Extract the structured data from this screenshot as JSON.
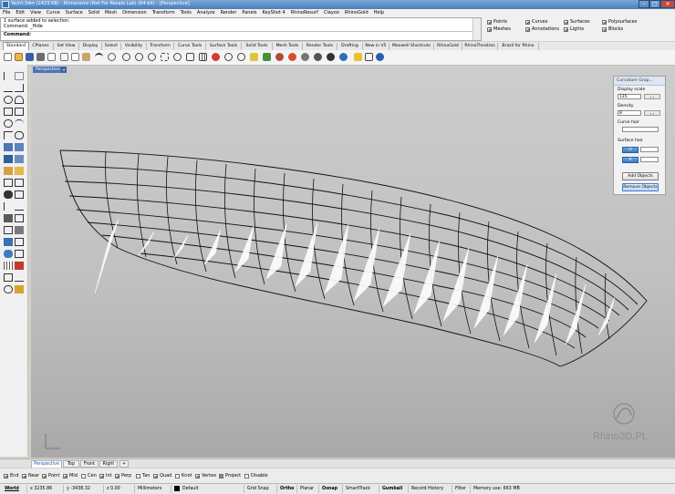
{
  "window": {
    "title": "Yacht.3dm (2423 KB) - Rhinoceros (Not For Resale Lab) (64-bit) - [Perspective]",
    "buttons": [
      "–",
      "□",
      "✕"
    ]
  },
  "menu": [
    "File",
    "Edit",
    "View",
    "Curve",
    "Surface",
    "Solid",
    "Mesh",
    "Dimension",
    "Transform",
    "Tools",
    "Analyze",
    "Render",
    "Panels",
    "KeyShot 4",
    "RhinoResurf",
    "Clayoo",
    "RhinoGold",
    "Help"
  ],
  "command": {
    "history": [
      "1 surface added to selection.",
      "Command: _Hide"
    ],
    "prompt": "Command:"
  },
  "select_filters": [
    "Points",
    "Curves",
    "Surfaces",
    "Polysurfaces",
    "Meshes",
    "Annotations",
    "Lights",
    "Blocks"
  ],
  "toolbar_tabs": [
    "Standard",
    "CPlanes",
    "Set View",
    "Display",
    "Select",
    "Visibility",
    "Transform",
    "Curve Tools",
    "Surface Tools",
    "Solid Tools",
    "Mesh Tools",
    "Render Tools",
    "Drafting",
    "New in V5",
    "Maxwell Shortcuts",
    "RhinoGold",
    "RhinoTheatros",
    "Brazil for Rhino"
  ],
  "viewport": {
    "title": "Perspective",
    "watermark": "RhinoЗD.PL"
  },
  "curvature_panel": {
    "title": "Curvature Grap...",
    "display_scale_label": "Display scale",
    "display_scale_value": "135",
    "density_label": "Density",
    "density_value": "8",
    "curve_hair_label": "Curve hair",
    "surface_hair_label": "Surface hair",
    "u_label": "U",
    "v_label": "V",
    "add_objects": "Add Objects",
    "remove_objects": "Remove Objects"
  },
  "view_tabs": [
    "Perspective",
    "Top",
    "Front",
    "Right"
  ],
  "add_view_icon": "plus-icon",
  "osnaps": [
    {
      "label": "End",
      "checked": true
    },
    {
      "label": "Near",
      "checked": true
    },
    {
      "label": "Point",
      "checked": true
    },
    {
      "label": "Mid",
      "checked": true
    },
    {
      "label": "Cen",
      "checked": false
    },
    {
      "label": "Int",
      "checked": true
    },
    {
      "label": "Perp",
      "checked": true
    },
    {
      "label": "Tan",
      "checked": false
    },
    {
      "label": "Quad",
      "checked": true
    },
    {
      "label": "Knot",
      "checked": false
    },
    {
      "label": "Vertex",
      "checked": true
    },
    {
      "label": "Project",
      "checked": false
    },
    {
      "label": "Disable",
      "checked": false
    }
  ],
  "status": {
    "cplane": "World",
    "x": "x 3235.86",
    "y": "y -3438.32",
    "z": "z 0.00",
    "units": "Millimeters",
    "layer": "Default",
    "grid_snap": "Grid Snap",
    "ortho": "Ortho",
    "planar": "Planar",
    "osnap": "Osnap",
    "smarttrack": "SmartTrack",
    "gumball": "Gumball",
    "record_history": "Record History",
    "filter": "Filter",
    "memory": "Memory use: 663 MB"
  },
  "colors": {
    "accent": "#3a7cc8",
    "layer_swatch": "#000000",
    "curvature_hair": "#ffffff",
    "hull_lines": "#111111"
  }
}
